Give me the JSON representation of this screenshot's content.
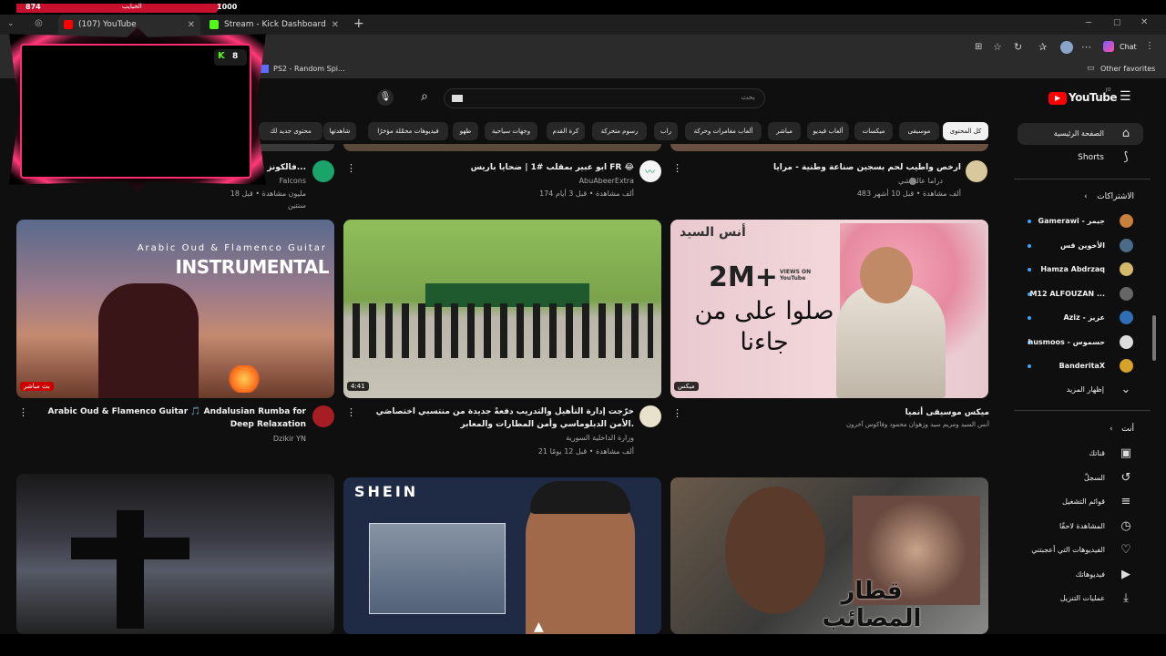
{
  "stream": {
    "left_count": "874",
    "right_count": "1000",
    "bar_label": "الحبايب",
    "kick_count": "8"
  },
  "browser": {
    "tabs": [
      {
        "label": "(107) YouTube"
      },
      {
        "label": "Stream - Kick Dashboard"
      }
    ],
    "new_tab": "+",
    "bookmark": "PS2 - Random Spi...",
    "other_favorites": "Other favorites",
    "chat_label": "Chat"
  },
  "youtube": {
    "logo_text": "YouTube",
    "logo_sup": "JO",
    "search_placeholder": "بحث",
    "search_query": "",
    "chips": [
      "كل المحتوى",
      "موسيقى",
      "ميكسات",
      "ألعاب فيديو",
      "مباشر",
      "ألعاب مغامرات وحركة",
      "راب",
      "رسوم متحركة",
      "كرة القدم",
      "وجهات سياحية",
      "طهو",
      "فيديوهات محمّلة مؤخرًا",
      "شاهدتها",
      "محتوى جديد لك"
    ],
    "sidebar": {
      "home": "الصفحة الرئيسية",
      "shorts": "Shorts",
      "subs_header": "الاشتراكات",
      "subs": [
        {
          "name": "Gamerawi - جيمر",
          "color": "#c9803d"
        },
        {
          "name": "الأخوين قس",
          "color": "#4a6b8a"
        },
        {
          "name": "Hamza Abdrzaq",
          "color": "#d4b96a"
        },
        {
          "name": "M12 ALFOUZAN ...",
          "color": "#666666"
        },
        {
          "name": "Aziz - عزيز",
          "color": "#2f6fb3"
        },
        {
          "name": "husmoos - حسموس",
          "color": "#dddddd"
        },
        {
          "name": "BanderitaX",
          "color": "#d6a22a"
        }
      ],
      "show_more": "إظهار المزيد",
      "you_header": "أنت",
      "you_items": [
        {
          "label": "قناتك",
          "icon": "channel-icon"
        },
        {
          "label": "السجلّ",
          "icon": "history-icon"
        },
        {
          "label": "قوائم التشغيل",
          "icon": "playlists-icon"
        },
        {
          "label": "المشاهدة لاحقًا",
          "icon": "clock-icon"
        },
        {
          "label": "الفيديوهات التي أعجبتني",
          "icon": "like-icon"
        },
        {
          "label": "فيديوهاتك",
          "icon": "video-icon"
        },
        {
          "label": "عمليات التنزيل",
          "icon": "download-icon"
        }
      ]
    },
    "top_row": [
      {
        "title": "ارخص واطيب لحم بسجين صناعة وطنية - مرايا",
        "channel": "دراما عالماشي",
        "meta": "483 ألف مشاهدة • قبل 10 أشهر"
      },
      {
        "title": "ابو عبير بمقلب #1 | ضحايا باريس FR 😂",
        "channel": "AbuAbeerExtra",
        "meta": "174 ألف مشاهدة • قبل 3 أيام"
      },
      {
        "title": "فالكونز في ر...",
        "channel": "Falcons",
        "meta": "18 مليون مشاهدة • قبل سنتين"
      }
    ],
    "videos": [
      {
        "title": "ميكس موسيقى أنميا",
        "channel": "أنس السيد ومريم سيد وزهوان محمود وفاكوس آخرون",
        "meta": "",
        "badge": "ميكس",
        "thumb_text_1": "2M+",
        "thumb_text_2": "VIEWS ON YouTube",
        "thumb_ar": "صلوا على من جاءنا",
        "brand": "أنس السيد"
      },
      {
        "title": "خرّجت إدارة التأهيل والتدريب دفعةً جديدة من منتسبي اختصاصَي الأمن الدبلوماسي وأمن المطارات والمعابر.",
        "channel": "وزارة الداخلية السورية",
        "meta": "21 ألف مشاهدة • قبل 12 يومًا",
        "badge": "4:41"
      },
      {
        "title": "Arabic Oud & Flamenco Guitar 🎵 Andalusian Rumba for Deep Relaxation",
        "channel": "Dzikir YN",
        "meta": "",
        "badge": "بث مباشر",
        "thumb_text_1": "Arabic Oud & Flamenco Guitar",
        "thumb_text_2": "INSTRUMENTAL"
      }
    ],
    "bottom": [
      {
        "thumb_ar": "قطار المصائب"
      },
      {
        "thumb_text": "SHEIN"
      },
      {
        "thumb_text": ""
      }
    ]
  }
}
